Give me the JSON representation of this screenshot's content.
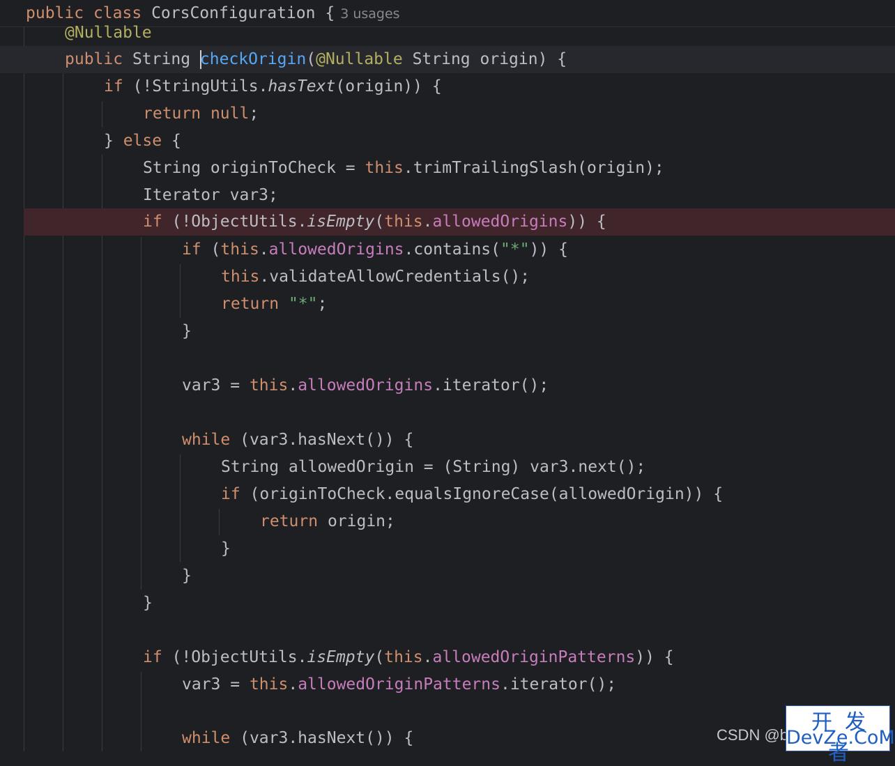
{
  "editor": {
    "class_line": {
      "kw_public": "public",
      "kw_class": "class",
      "class_name": "CorsConfiguration",
      "brace": "{",
      "usages_hint": "3 usages"
    },
    "annotation_line": "@Nullable",
    "method_line": {
      "kw_public": "public",
      "type": "String",
      "method_name": "checkOrigin",
      "open_paren": "(",
      "param_annotation": "@Nullable",
      "params_rest": " String origin) {"
    },
    "lines": {
      "l4": {
        "kw": "if",
        "a": " (!StringUtils.",
        "m": "hasText",
        "b": "(origin)) {"
      },
      "l5": {
        "kw": "return",
        "kw2": "null",
        "rest": ";"
      },
      "l6": {
        "a": "} ",
        "kw": "else",
        "b": " {"
      },
      "l7": {
        "a": "String originToCheck = ",
        "kw": "this",
        "b": ".trimTrailingSlash(origin);"
      },
      "l8": {
        "a": "Iterator var3;"
      },
      "l9": {
        "kw": "if",
        "a": " (!ObjectUtils.",
        "m": "isEmpty",
        "b": "(",
        "kw2": "this",
        "c": ".",
        "f": "allowedOrigins",
        "d": ")) {"
      },
      "l10": {
        "kw": "if",
        "a": " (",
        "kw2": "this",
        "b": ".",
        "f": "allowedOrigins",
        "c": ".contains(",
        "s": "\"*\"",
        "d": ")) {"
      },
      "l11": {
        "kw": "this",
        "a": ".validateAllowCredentials();"
      },
      "l12": {
        "kw": "return",
        "a": " ",
        "s": "\"*\"",
        "b": ";"
      },
      "l13": {
        "a": "}"
      },
      "l15": {
        "a": "var3 = ",
        "kw": "this",
        "b": ".",
        "f": "allowedOrigins",
        "c": ".iterator();"
      },
      "l17": {
        "kw": "while",
        "a": " (var3.hasNext()) {"
      },
      "l18": {
        "a": "String allowedOrigin = (String) var3.next();"
      },
      "l19": {
        "kw": "if",
        "a": " (originToCheck.equalsIgnoreCase(allowedOrigin)) {"
      },
      "l20": {
        "kw": "return",
        "a": " origin;"
      },
      "l21": {
        "a": "}"
      },
      "l22": {
        "a": "}"
      },
      "l23": {
        "a": "}"
      },
      "l25": {
        "kw": "if",
        "a": " (!ObjectUtils.",
        "m": "isEmpty",
        "b": "(",
        "kw2": "this",
        "c": ".",
        "f": "allowedOriginPatterns",
        "d": ")) {"
      },
      "l26": {
        "a": "var3 = ",
        "kw": "this",
        "b": ".",
        "f": "allowedOriginPatterns",
        "c": ".iterator();"
      },
      "l28": {
        "kw": "while",
        "a": " (var3.hasNext()) {"
      }
    }
  },
  "watermark": {
    "csdn_text": "CSDN @b",
    "logo_cn": "开发者",
    "logo_en": "DevZe.CoM"
  },
  "colors": {
    "background": "#1e1f22",
    "keyword": "#cf8e6d",
    "annotation": "#b3ae60",
    "method_declaration": "#56a8f5",
    "field": "#c77dbb",
    "string": "#6aab73",
    "breakpoint_line": "#40252b"
  }
}
